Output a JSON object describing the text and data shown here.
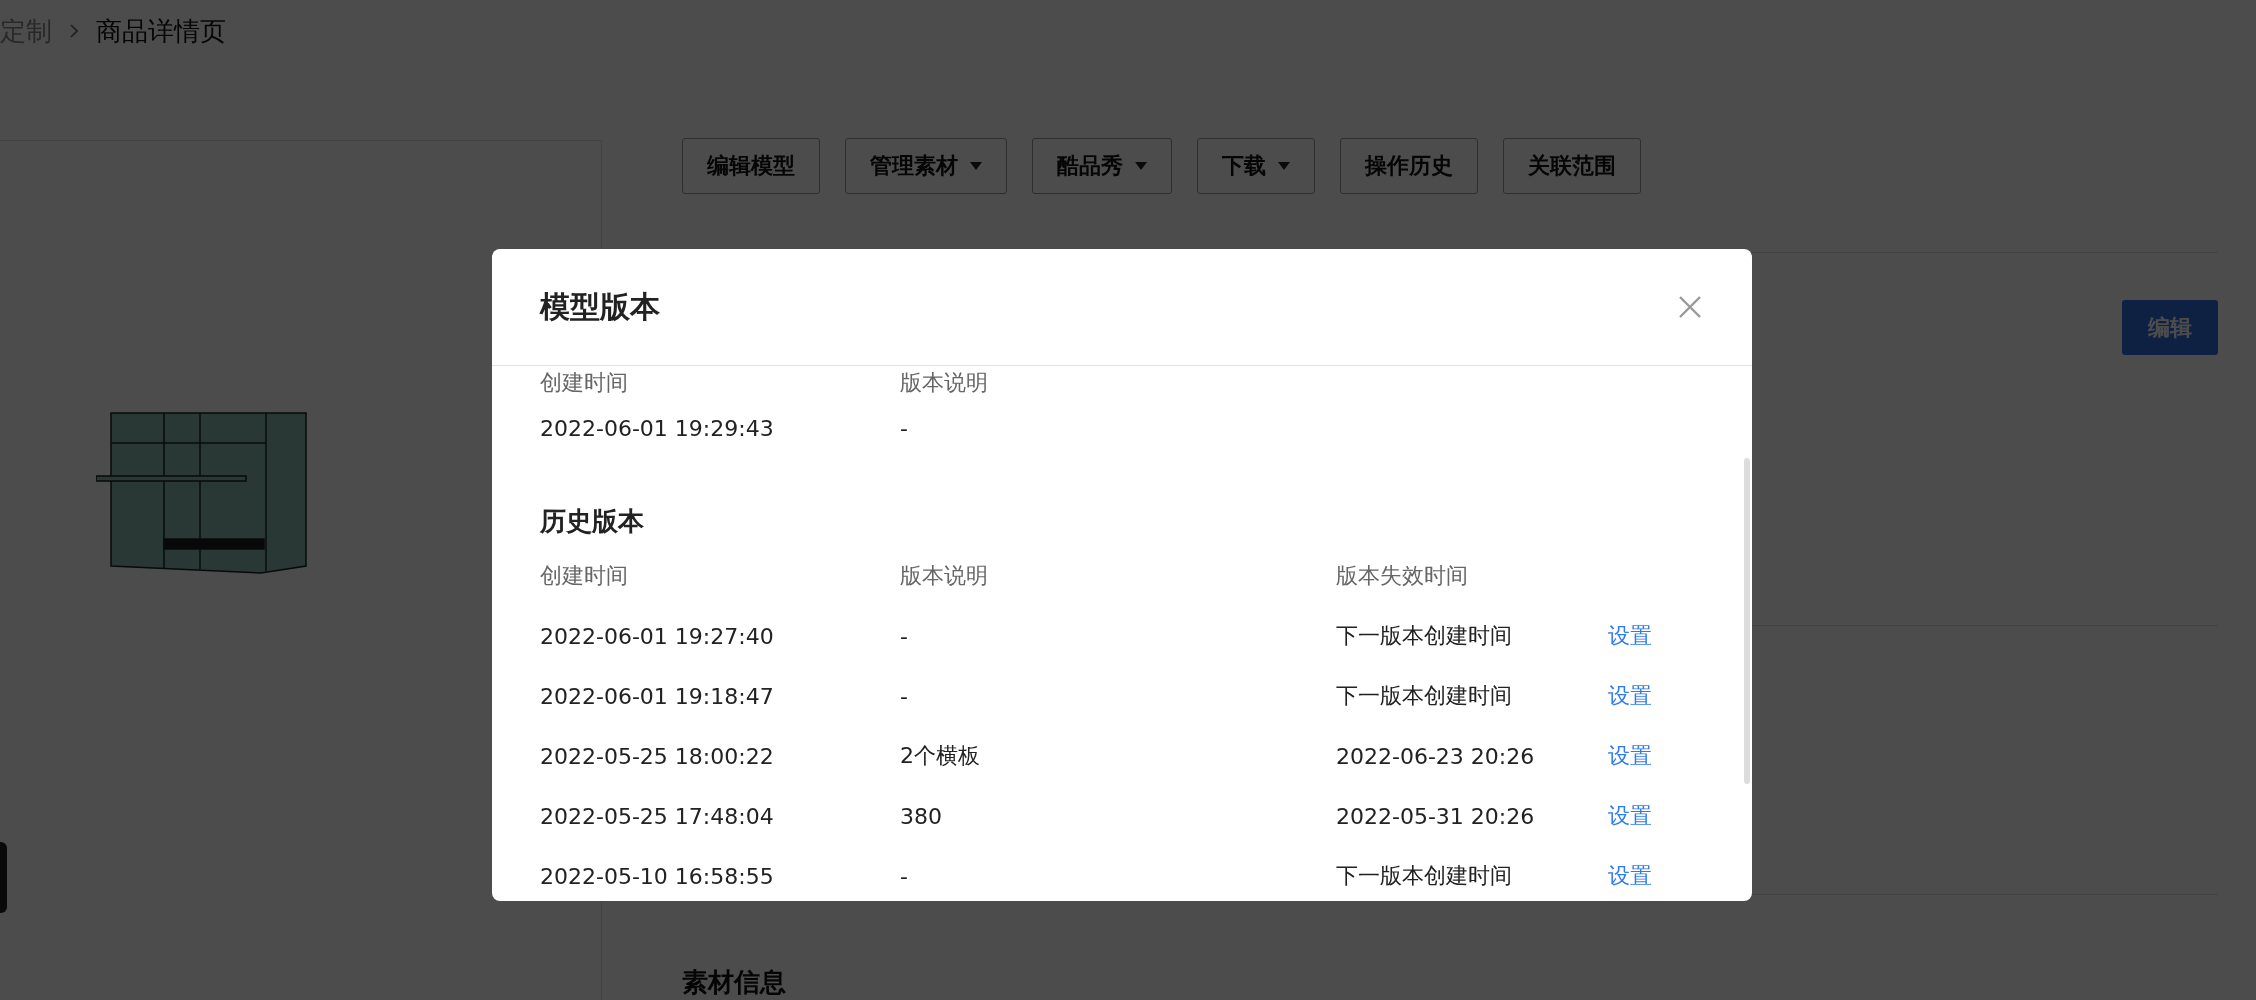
{
  "breadcrumb": [
    {
      "label": "定制",
      "current": false
    },
    {
      "label": "商品详情页",
      "current": true
    }
  ],
  "toolbar": [
    {
      "label": "编辑模型",
      "dropdown": false
    },
    {
      "label": "管理素材",
      "dropdown": true
    },
    {
      "label": "酷品秀",
      "dropdown": true
    },
    {
      "label": "下载",
      "dropdown": true
    },
    {
      "label": "操作历史",
      "dropdown": false
    },
    {
      "label": "关联范围",
      "dropdown": false
    }
  ],
  "edit_button": "编辑",
  "section_title": "素材信息",
  "modal": {
    "title": "模型版本",
    "current": {
      "columns": [
        "创建时间",
        "版本说明"
      ],
      "rows": [
        [
          "2022-06-01 19:29:43",
          "-"
        ]
      ]
    },
    "history": {
      "title": "历史版本",
      "columns": [
        "创建时间",
        "版本说明",
        "版本失效时间"
      ],
      "rows": [
        {
          "created": "2022-06-01 19:27:40",
          "note": "-",
          "expires": "下一版本创建时间",
          "action": "设置"
        },
        {
          "created": "2022-06-01 19:18:47",
          "note": "-",
          "expires": "下一版本创建时间",
          "action": "设置"
        },
        {
          "created": "2022-05-25 18:00:22",
          "note": "2个横板",
          "expires": "2022-06-23 20:26",
          "action": "设置"
        },
        {
          "created": "2022-05-25 17:48:04",
          "note": "380",
          "expires": "2022-05-31 20:26",
          "action": "设置"
        },
        {
          "created": "2022-05-10 16:58:55",
          "note": "-",
          "expires": "下一版本创建时间",
          "action": "设置"
        }
      ]
    }
  }
}
